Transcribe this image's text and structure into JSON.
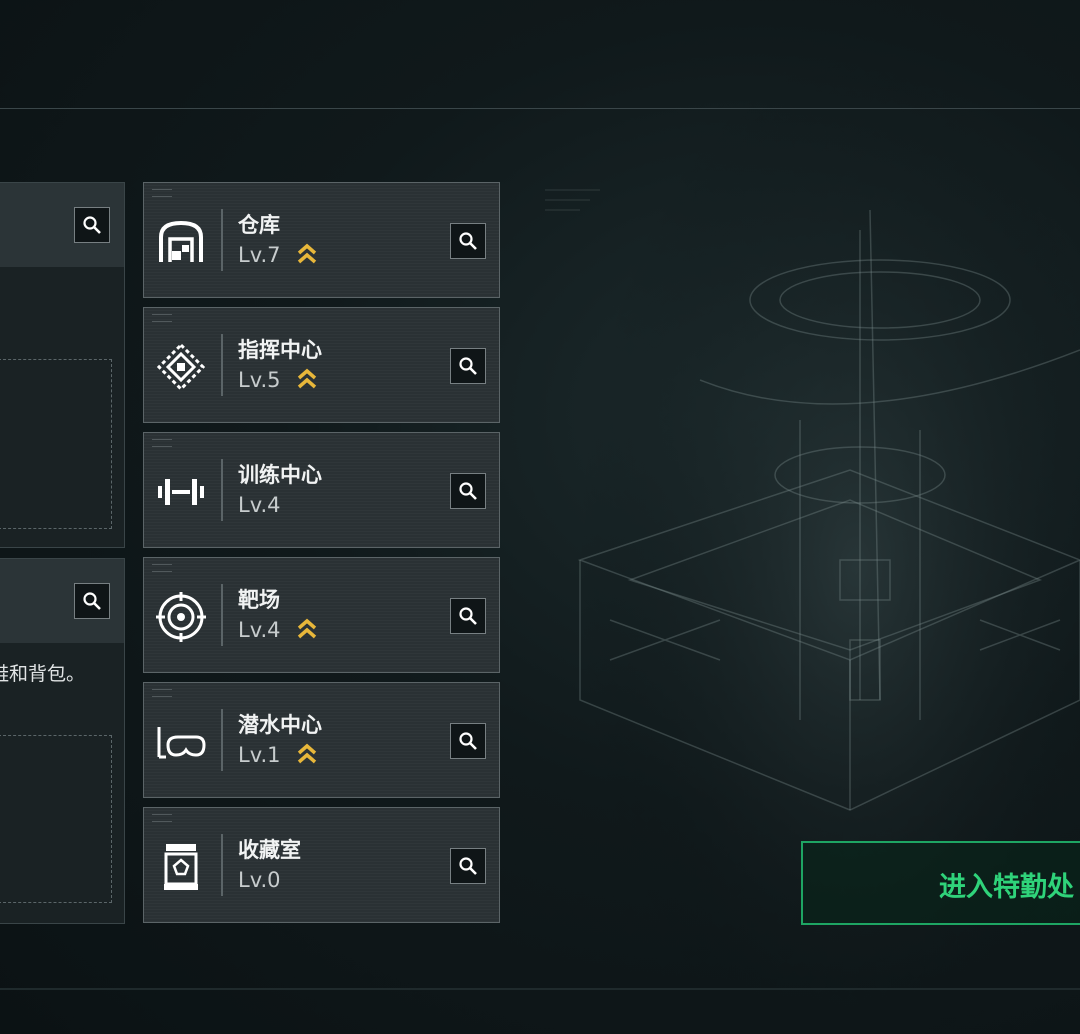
{
  "facilities": [
    {
      "name": "仓库",
      "level": "Lv.7",
      "upgradable": true,
      "icon": "warehouse-icon"
    },
    {
      "name": "指挥中心",
      "level": "Lv.5",
      "upgradable": true,
      "icon": "command-chip-icon"
    },
    {
      "name": "训练中心",
      "level": "Lv.4",
      "upgradable": false,
      "icon": "dumbbell-icon"
    },
    {
      "name": "靶场",
      "level": "Lv.4",
      "upgradable": true,
      "icon": "target-icon"
    },
    {
      "name": "潜水中心",
      "level": "Lv.1",
      "upgradable": true,
      "icon": "diving-mask-icon"
    },
    {
      "name": "收藏室",
      "level": "Lv.0",
      "upgradable": false,
      "icon": "display-case-icon"
    }
  ],
  "left_panel": {
    "partial_text": "鞋和背包。"
  },
  "enter_button": {
    "label": "进入特勤处"
  },
  "colors": {
    "accent_green": "#2fd37a",
    "upgrade_gold": "#e8b73a",
    "card_bg": "#2a3134"
  }
}
